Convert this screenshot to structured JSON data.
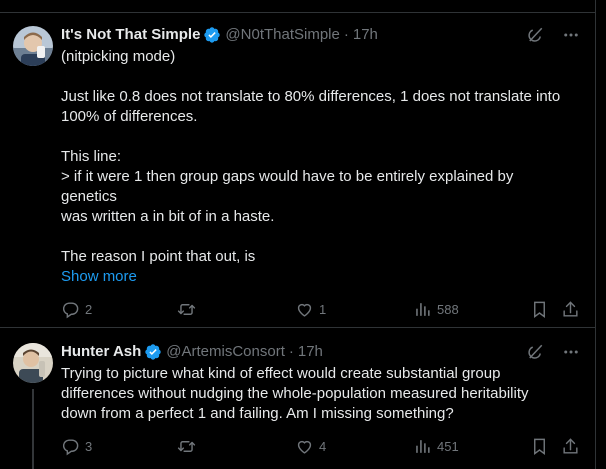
{
  "tweets": [
    {
      "name": "It's Not That Simple",
      "handle": "@N0tThatSimple",
      "time": "17h",
      "paragraphs": [
        "(nitpicking mode)",
        "Just like 0.8 does not translate to 80% differences, 1 does not translate into\n100% of differences.",
        "This line:\n> if it were 1 then group gaps would have to be entirely explained by\ngenetics\nwas written a in bit of in a haste.",
        "The reason I point that out, is"
      ],
      "show_more": "Show more",
      "replies": "2",
      "retweets": "",
      "likes": "1",
      "views": "588"
    },
    {
      "name": "Hunter Ash",
      "handle": "@ArtemisConsort",
      "time": "17h",
      "paragraphs": [
        "Trying to picture what kind of effect would create substantial group\ndifferences without nudging the whole-population measured heritability\ndown from a perfect 1 and failing. Am I missing something?"
      ],
      "replies": "3",
      "retweets": "",
      "likes": "4",
      "views": "451"
    }
  ],
  "separator": "·",
  "colors": {
    "background": "#000000",
    "text": "#e7e9ea",
    "muted": "#71767b",
    "link": "#1d9bf0",
    "verified": "#1d9bf0",
    "border": "#2f3336"
  },
  "icons": [
    "verified-badge-icon",
    "grok-icon",
    "more-icon",
    "reply-icon",
    "retweet-icon",
    "like-icon",
    "views-icon",
    "bookmark-icon",
    "share-icon"
  ]
}
